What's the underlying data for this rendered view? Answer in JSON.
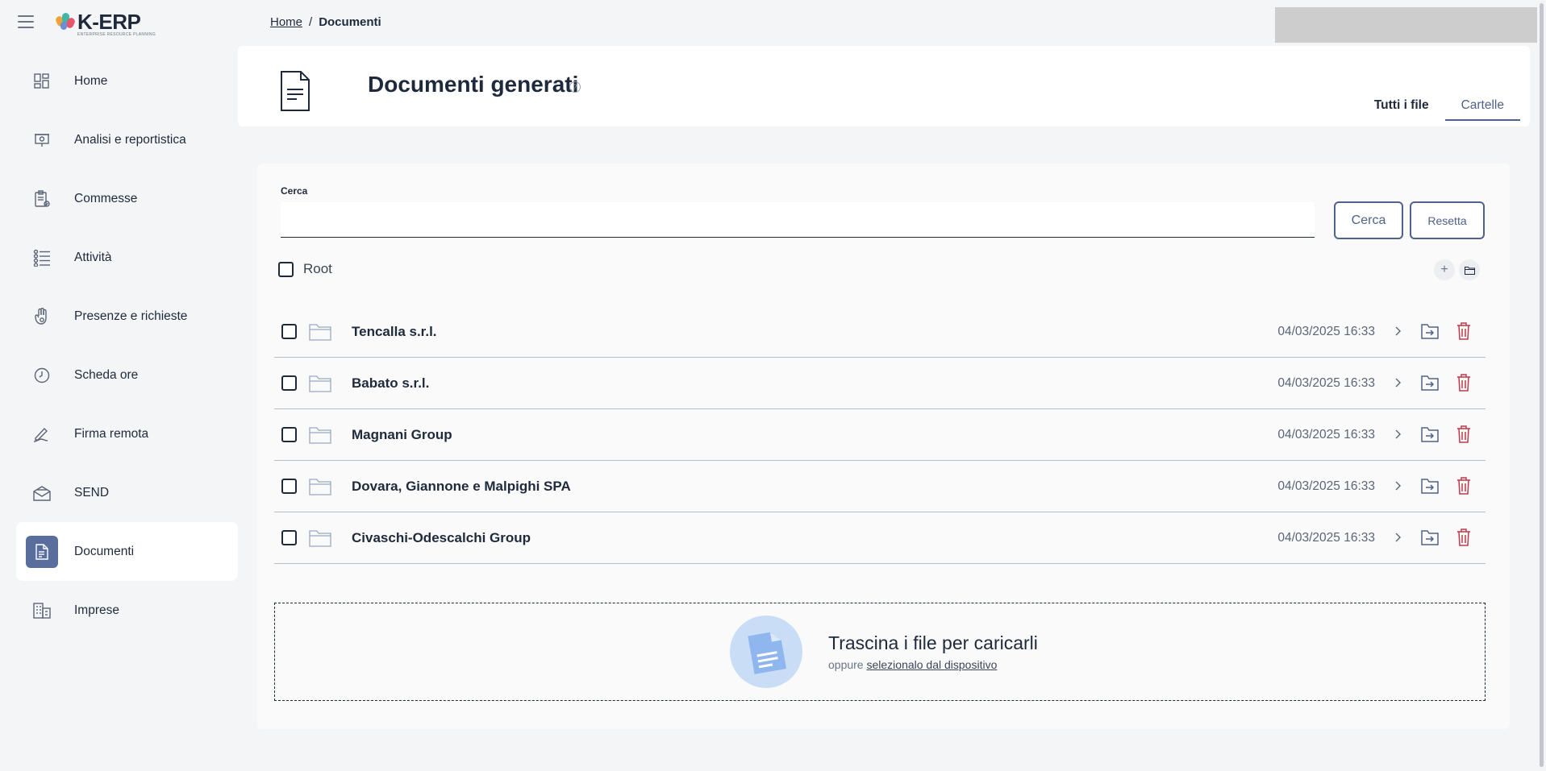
{
  "app": {
    "logo_text": "K-ERP",
    "logo_subtitle": "ENTERPRISE RESOURCE PLANNING"
  },
  "sidebar": {
    "items": [
      {
        "label": "Home",
        "icon": "dashboard-icon"
      },
      {
        "label": "Analisi e reportistica",
        "icon": "presentation-icon"
      },
      {
        "label": "Commesse",
        "icon": "clipboard-check-icon"
      },
      {
        "label": "Attività",
        "icon": "checklist-icon"
      },
      {
        "label": "Presenze e richieste",
        "icon": "hand-gesture-icon"
      },
      {
        "label": "Scheda ore",
        "icon": "clock-icon"
      },
      {
        "label": "Firma remota",
        "icon": "signature-icon"
      },
      {
        "label": "SEND",
        "icon": "envelope-icon"
      },
      {
        "label": "Documenti",
        "icon": "document-icon",
        "active": true
      },
      {
        "label": "Imprese",
        "icon": "building-icon"
      }
    ]
  },
  "breadcrumb": {
    "home": "Home",
    "separator": "/",
    "current": "Documenti"
  },
  "header": {
    "title": "Documenti generati",
    "help": "?",
    "tabs": [
      {
        "label": "Tutti i file",
        "selected": false
      },
      {
        "label": "Cartelle",
        "selected": true
      }
    ]
  },
  "search": {
    "label": "Cerca",
    "value": "",
    "search_button": "Cerca",
    "reset_button": "Resetta"
  },
  "root": {
    "label": "Root",
    "add_icon": "+"
  },
  "folders": [
    {
      "name": "Tencalla s.r.l.",
      "date": "04/03/2025 16:33"
    },
    {
      "name": "Babato s.r.l.",
      "date": "04/03/2025 16:33"
    },
    {
      "name": "Magnani Group",
      "date": "04/03/2025 16:33"
    },
    {
      "name": "Dovara, Giannone e Malpighi SPA",
      "date": "04/03/2025 16:33"
    },
    {
      "name": "Civaschi-Odescalchi Group",
      "date": "04/03/2025 16:33"
    }
  ],
  "dropzone": {
    "title": "Trascina i file per caricarli",
    "sub_prefix": "oppure",
    "sub_link": "selezionalo dal dispositivo"
  },
  "colors": {
    "accent": "#4f6289",
    "active_icon_bg": "#5a6e9e",
    "delete": "#c0394b",
    "folder": "#9aa9c4"
  }
}
